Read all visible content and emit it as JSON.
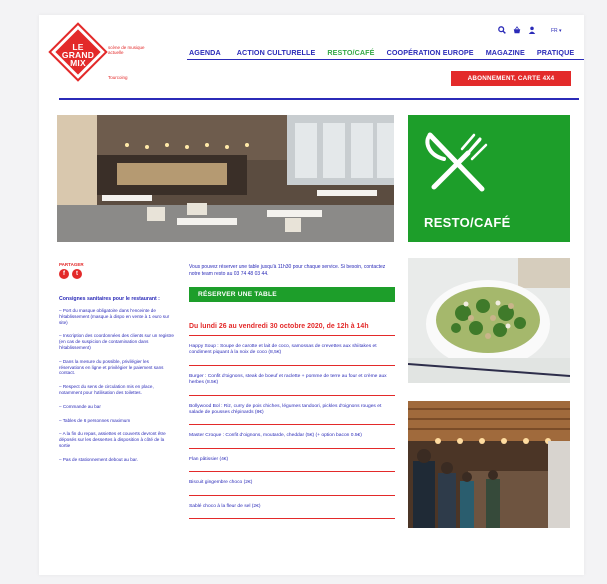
{
  "brand": {
    "logo_line1": "LE",
    "logo_line2": "GRAND",
    "logo_line3": "MIX",
    "tagline": "scène de musique actuelle",
    "city": "Tourcoing"
  },
  "utility": {
    "lang": "FR ▾"
  },
  "nav": [
    {
      "label": "AGENDA",
      "active": false
    },
    {
      "label": "ACTION CULTURELLE",
      "active": false
    },
    {
      "label": "RESTO/CAFÉ",
      "active": true
    },
    {
      "label": "COOPÉRATION EUROPE",
      "active": false
    },
    {
      "label": "MAGAZINE",
      "active": false
    },
    {
      "label": "PRATIQUE",
      "active": false
    }
  ],
  "subscribe_label": "ABONNEMENT, CARTE 4X4",
  "hero": {
    "tile_title": "RESTO/CAFÉ"
  },
  "share": {
    "label": "PARTAGER",
    "facebook": "f",
    "twitter": "t"
  },
  "sanitary": {
    "title": "Consignes sanitaires pour le restaurant :",
    "items": [
      "– Port du masque obligatoire dans l'enceinte de l'établissement (masque à dispo en vente à 1 euro sur site)",
      "– Inscription des coordonnées des clients sur un registre (en cas de suspicion de contamination dans l'établissement)",
      "– Dans la mesure du possible, privilégier les réservations en ligne et privilégier le paiement sans contact.",
      "– Respect du sens de circulation mis en place, notamment pour l'utilisation des toilettes.",
      "– Commande au bar",
      "– Tables de 6 personnes maximum",
      "– A la fin du repas, assiettes et couverts devront être déposés sur les dessertes à disposition à côté de la sortie",
      "– Pas de stationnement debout au bar."
    ]
  },
  "intro": "Vous pouvez réserver une table jusqu'à 11h30 pour chaque service. Si besoin, contactez notre team resto au 03 74 48 03 44.",
  "reserve_label": "RÉSERVER UNE TABLE",
  "menu": {
    "date": "Du lundi 26 au vendredi 30 octobre 2020, de 12h à 14h",
    "items": [
      "Happy Soup : Soupe de carotte et lait de coco, samossas de crevettes aux shiitakes et condiment piquant à la noix de coco (8,5€)",
      "Burger : Confit d'oignons, steak de boeuf et raclette + pomme de terre au four et crème aux herbes (8.5€)",
      "Bollywood Bol : Riz, curry de pois chiches, légumes tandoori, pickles d'oignons rouges et salade de pousses d'épinards (8€)",
      "Master Croque : Confit d'oignons, moutarde, cheddar (5€) (+ option bacon 0.5€)",
      "Flan pâtissier (4€)",
      "Biscuit gingembre choco (2€)",
      "Sablé choco à la fleur de sel (2€)"
    ]
  },
  "colors": {
    "brand_red": "#e32a2a",
    "nav_blue": "#2b2bb8",
    "accent_green": "#1d9e2a"
  }
}
